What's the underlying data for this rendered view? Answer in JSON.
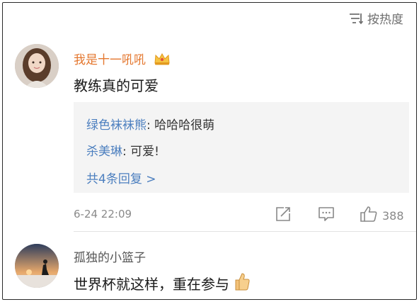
{
  "header": {
    "sort_label": "按热度",
    "sort_icon": "sort-lines-icon"
  },
  "comment1": {
    "username": "我是十一吼吼",
    "badge_icon": "crown-badge-icon",
    "text": "教练真的可爱",
    "replies": [
      {
        "name": "绿色袜袜熊",
        "sep": ": ",
        "text": "哈哈哈很萌"
      },
      {
        "name": "杀美琳",
        "sep": ": ",
        "text": "可爱!"
      }
    ],
    "more_replies": "共4条回复 >",
    "timestamp": "6-24 22:09",
    "actions": {
      "share_icon": "edit-share-icon",
      "comment_icon": "comment-icon",
      "like_icon": "thumbs-up-icon",
      "like_count": "388"
    }
  },
  "comment2": {
    "username": "孤独的小篮子",
    "text": "世界杯就这样，重在参与",
    "emoji_icon": "thumbs-up-emoji-icon"
  },
  "colors": {
    "username": "#e4772f",
    "link": "#4c7fbf",
    "reply_bg": "#f4f4f4",
    "muted": "#888888"
  }
}
